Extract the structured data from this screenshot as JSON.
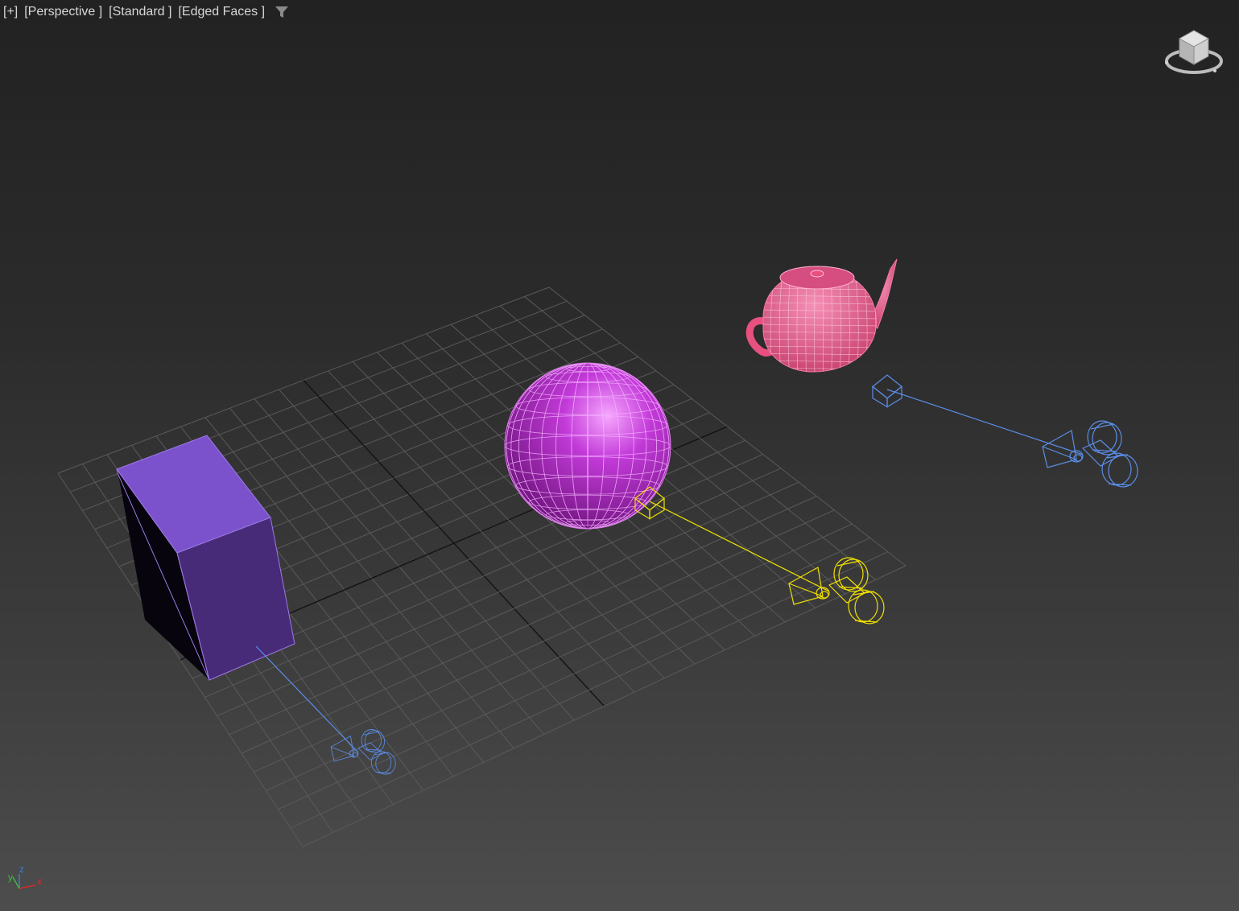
{
  "viewport": {
    "labels": {
      "plus": "[+]",
      "view": "[Perspective ]",
      "shading_style": "[Standard ]",
      "display_mode": "[Edged Faces ]"
    },
    "filter_icon": "filter-icon",
    "navigation": "viewcube",
    "axis_tripod": {
      "x": "x",
      "y": "y",
      "z": "z"
    }
  },
  "scene_objects": [
    {
      "name": "box",
      "type": "box",
      "color": "#7b4fc9"
    },
    {
      "name": "sphere",
      "type": "sphere",
      "color": "#c23ad8"
    },
    {
      "name": "teapot",
      "type": "teapot",
      "color": "#e8507f"
    },
    {
      "name": "camera-yellow",
      "type": "target-camera",
      "color": "#f0e000",
      "selected": true
    },
    {
      "name": "camera-blue-right",
      "type": "target-camera",
      "color": "#5b8ee8"
    },
    {
      "name": "camera-blue-left",
      "type": "target-camera",
      "color": "#5b8ee8"
    }
  ],
  "colors": {
    "grid": "#5a5a5a",
    "grid_axis": "#111111",
    "selected": "#f0e000",
    "unselected_camera": "#5b8ee8"
  }
}
